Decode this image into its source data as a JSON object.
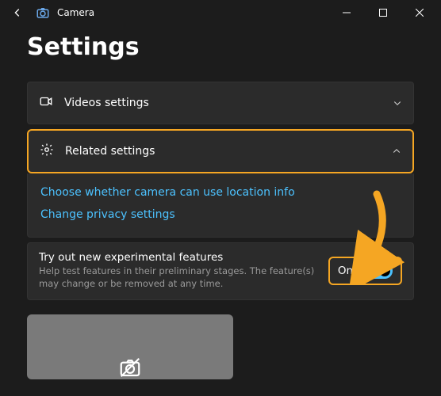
{
  "app": {
    "title": "Camera"
  },
  "page_title": "Settings",
  "rows": {
    "videos": {
      "label": "Videos settings"
    },
    "related": {
      "label": "Related settings"
    }
  },
  "links": {
    "location": "Choose whether camera can use location info",
    "privacy": "Change privacy settings"
  },
  "experimental": {
    "title": "Try out new experimental features",
    "subtitle": "Help test features in their preliminary stages. The feature(s) may change or be removed at any time.",
    "state_label": "On",
    "state": true
  },
  "colors": {
    "highlight": "#f5a623",
    "link": "#4cc2ff",
    "panel": "#2b2b2b"
  }
}
